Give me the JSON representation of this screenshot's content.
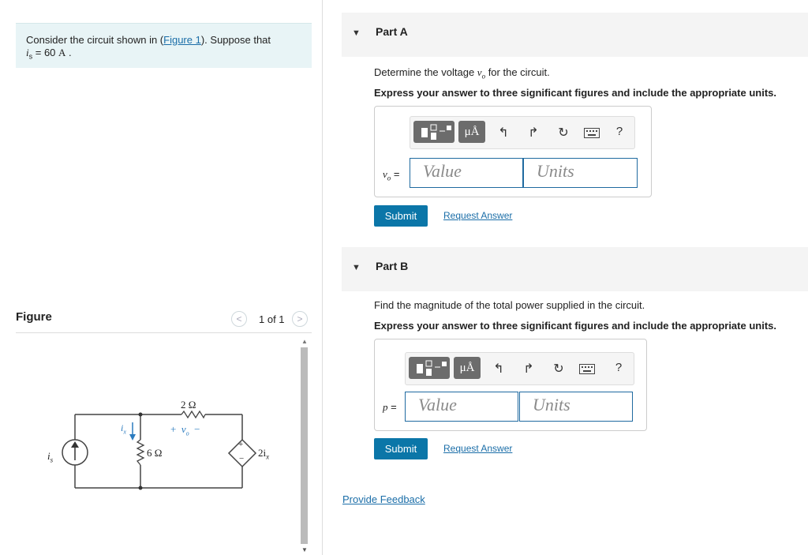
{
  "problem": {
    "text_before": "Consider the circuit shown in (",
    "figure_link": "Figure 1",
    "text_after": "). Suppose that",
    "var": "i",
    "var_sub": "s",
    "eq": " = 60 ",
    "unit": "A",
    "period": " ."
  },
  "figure": {
    "label": "Figure",
    "pager": "1 of 1",
    "prev": "<",
    "next": ">",
    "circuit": {
      "r_top": "2 Ω",
      "r_mid": "6 Ω",
      "src_label_var": "i",
      "src_label_sub": "s",
      "ix_label": "i",
      "ix_sub": "x",
      "vo_plus": "+",
      "vo_var": "v",
      "vo_sub": "o",
      "vo_minus": "−",
      "dep_label": "2i",
      "dep_sub": "x",
      "dep_plus": "+",
      "dep_minus": "−"
    }
  },
  "partA": {
    "title": "Part A",
    "question_pre": "Determine the voltage ",
    "question_var": "v",
    "question_sub": "o",
    "question_post": " for the circuit.",
    "instruction": "Express your answer to three significant figures and include the appropriate units.",
    "var_label": "v",
    "var_sub": "o",
    "equals": " =",
    "value_placeholder": "Value",
    "units_placeholder": "Units",
    "mu_label": "μÅ",
    "help": "?",
    "submit": "Submit",
    "request": "Request Answer"
  },
  "partB": {
    "title": "Part B",
    "question": "Find the magnitude of the total power supplied in the circuit.",
    "instruction": "Express your answer to three significant figures and include the appropriate units.",
    "var_label": "p",
    "equals": " =",
    "value_placeholder": "Value",
    "units_placeholder": "Units",
    "mu_label": "μÅ",
    "help": "?",
    "submit": "Submit",
    "request": "Request Answer"
  },
  "feedback": "Provide Feedback",
  "icons": [
    "template-icon",
    "mu-angstrom-icon",
    "undo-icon",
    "redo-icon",
    "reset-icon",
    "keyboard-icon",
    "help-icon"
  ],
  "colors": {
    "accent": "#0b76a8",
    "link": "#1b6ea8",
    "problem_bg": "#e8f4f6",
    "input_border": "#1f6aa0"
  }
}
